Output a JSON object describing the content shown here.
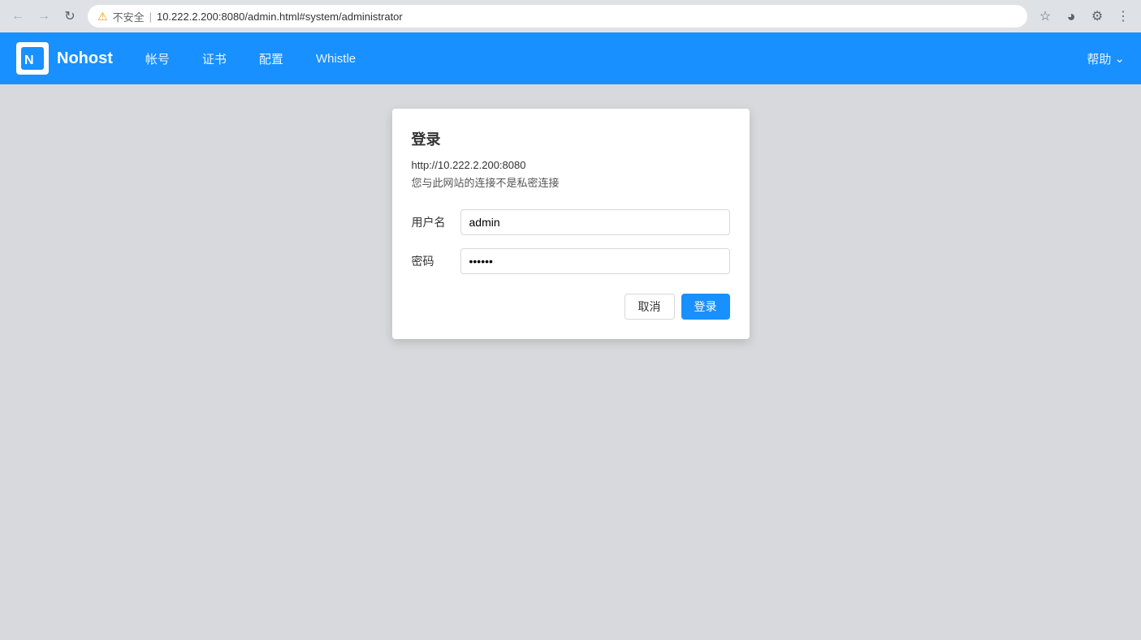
{
  "browser": {
    "url": "10.222.2.200:8080/admin.html#system/administrator",
    "url_full": "10.222.2.200:8080/admin.html#system/administrator",
    "security_label": "不安全",
    "nav": {
      "back": "←",
      "forward": "→",
      "reload": "↻"
    }
  },
  "navbar": {
    "logo_text": "Nohost",
    "items": [
      "帐号",
      "证书",
      "配置",
      "Whistle"
    ],
    "help": "帮助"
  },
  "dialog": {
    "title": "登录",
    "url": "http://10.222.2.200:8080",
    "warning": "您与此网站的连接不是私密连接",
    "username_label": "用户名",
    "username_value": "admin",
    "password_label": "密码",
    "password_value": "••••••",
    "cancel_label": "取消",
    "login_label": "登录"
  }
}
